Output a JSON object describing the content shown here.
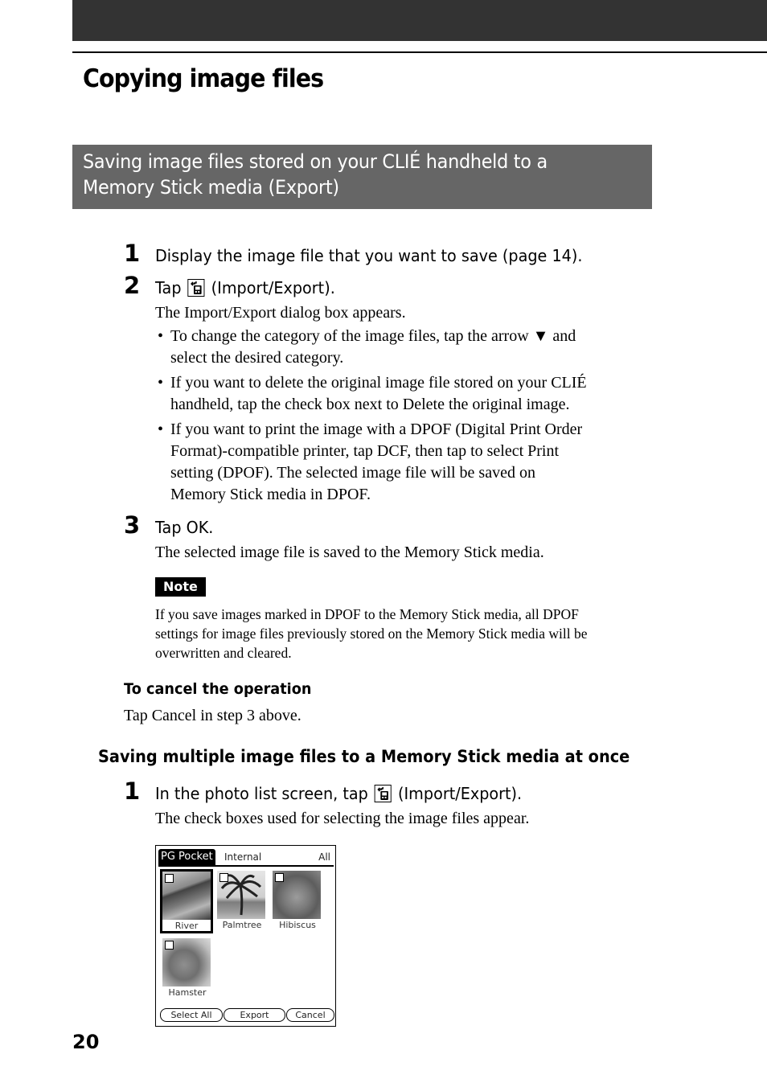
{
  "page": {
    "chapter_title": "Copying image files",
    "page_number": "20"
  },
  "section": {
    "title_line1": "Saving image files stored on your CLIÉ handheld to a",
    "title_line2": "Memory Stick media (Export)"
  },
  "steps": [
    {
      "num": "1",
      "text": "Display the image file that you want to save (page 14)."
    },
    {
      "num": "2",
      "text_before": "Tap",
      "icon": "import-export-icon",
      "text_after": "(Import/Export).",
      "result": "The Import/Export dialog box appears."
    },
    {
      "num": "3",
      "text": "Tap OK.",
      "result": "The selected image file is saved to the Memory Stick media."
    }
  ],
  "bullets": [
    {
      "line1": "To change the category of the image files, tap the arrow ▼ and",
      "line2": "select the desired category."
    },
    {
      "line1": "If you want to delete the original image file stored on your CLIÉ",
      "line2": "handheld, tap the check box next to Delete the original image."
    },
    {
      "line1": "If you want to print the image with a DPOF (Digital Print Order",
      "line2": "Format)-compatible printer, tap DCF, then tap to select Print",
      "line3": "setting (DPOF). The selected image file will be saved on",
      "line4": "Memory Stick media in DPOF."
    }
  ],
  "note": {
    "label": "Note",
    "line1": "If you save images marked in DPOF to the Memory Stick media, all DPOF",
    "line2": "settings for image files previously stored on the Memory Stick media will be",
    "line3": "overwritten and cleared."
  },
  "cancel": {
    "heading": "To cancel the operation",
    "text": "Tap Cancel in step 3 above."
  },
  "multi": {
    "heading": "Saving multiple image files to a Memory Stick media at once",
    "step_num": "1",
    "step_before": "In the photo list screen, tap",
    "step_after": "(Import/Export).",
    "result": "The check boxes used for selecting the image files appear."
  },
  "device": {
    "tab_active": "PG Pocket",
    "tab_internal": "Internal",
    "category": "All",
    "photos": [
      {
        "label": "River",
        "selected": true,
        "checked": false
      },
      {
        "label": "Palmtree",
        "selected": false,
        "checked": false
      },
      {
        "label": "Hibiscus",
        "selected": false,
        "checked": false
      },
      {
        "label": "Hamster",
        "selected": false,
        "checked": false
      }
    ],
    "buttons": {
      "select_all": "Select All",
      "export": "Export",
      "cancel": "Cancel"
    }
  }
}
